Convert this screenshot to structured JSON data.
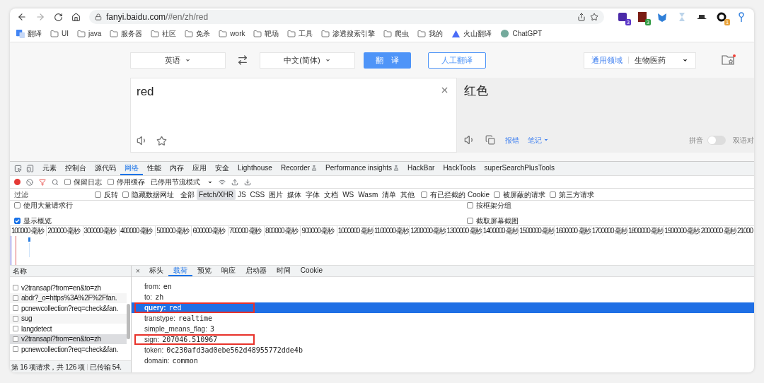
{
  "browser": {
    "host": "fanyi.baidu.com",
    "path": "/#en/zh/red",
    "extensions": [
      {
        "kind": "cube",
        "badge": "3",
        "color": "#5b36c9"
      },
      {
        "kind": "book",
        "badge": "3",
        "color": "#2f9a41"
      },
      {
        "kind": "fox"
      },
      {
        "kind": "hourglass"
      },
      {
        "kind": "hat"
      },
      {
        "kind": "ring",
        "badge": "1",
        "color": "#e8a23a"
      },
      {
        "kind": "pin"
      }
    ],
    "bookmarks": [
      {
        "label": "翻译",
        "kind": "translate"
      },
      {
        "label": "UI",
        "kind": "folder"
      },
      {
        "label": "java",
        "kind": "folder"
      },
      {
        "label": "服务器",
        "kind": "folder"
      },
      {
        "label": "社区",
        "kind": "folder"
      },
      {
        "label": "免杀",
        "kind": "folder"
      },
      {
        "label": "work",
        "kind": "folder"
      },
      {
        "label": "靶场",
        "kind": "folder"
      },
      {
        "label": "工具",
        "kind": "folder"
      },
      {
        "label": "渗透搜索引擎",
        "kind": "folder"
      },
      {
        "label": "爬虫",
        "kind": "folder"
      },
      {
        "label": "我的",
        "kind": "folder"
      },
      {
        "label": "火山翻译",
        "kind": "volcano"
      },
      {
        "label": "ChatGPT",
        "kind": "chatgpt"
      }
    ]
  },
  "translator": {
    "source_lang": "英语",
    "target_lang": "中文(简体)",
    "translate_button": "翻　译",
    "human_button": "人工翻译",
    "domain_label": "通用领域",
    "domain_value": "生物医药",
    "source_text": "red",
    "result_text": "红色",
    "report_link": "报错",
    "notes_link": "笔记",
    "pinyin_label": "拼音",
    "pinyin_on": false,
    "bilingual_label": "双语对"
  },
  "devtools": {
    "tabs": [
      {
        "label": "元素",
        "selected": false,
        "beta": false
      },
      {
        "label": "控制台",
        "selected": false,
        "beta": false
      },
      {
        "label": "源代码",
        "selected": false,
        "beta": false
      },
      {
        "label": "网络",
        "selected": true,
        "beta": false
      },
      {
        "label": "性能",
        "selected": false,
        "beta": false
      },
      {
        "label": "内存",
        "selected": false,
        "beta": false
      },
      {
        "label": "应用",
        "selected": false,
        "beta": false
      },
      {
        "label": "安全",
        "selected": false,
        "beta": false
      },
      {
        "label": "Lighthouse",
        "selected": false,
        "beta": false
      },
      {
        "label": "Recorder",
        "selected": false,
        "beta": true
      },
      {
        "label": "Performance insights",
        "selected": false,
        "beta": true
      },
      {
        "label": "HackBar",
        "selected": false,
        "beta": false
      },
      {
        "label": "HackTools",
        "selected": false,
        "beta": false
      },
      {
        "label": "superSearchPlusTools",
        "selected": false,
        "beta": false
      }
    ],
    "recording": true,
    "toolbar_checks": [
      {
        "label": "保留日志",
        "checked": false
      },
      {
        "label": "停用缓存",
        "checked": false
      }
    ],
    "throttling": "已停用节流模式",
    "filter_placeholder": "过滤",
    "filter_checks": [
      {
        "label": "反转",
        "checked": false
      },
      {
        "label": "隐藏数据网址",
        "checked": false
      }
    ],
    "types": [
      {
        "label": "全部",
        "selected": false
      },
      {
        "label": "Fetch/XHR",
        "selected": true
      },
      {
        "label": "JS",
        "selected": false
      },
      {
        "label": "CSS",
        "selected": false
      },
      {
        "label": "图片",
        "selected": false
      },
      {
        "label": "媒体",
        "selected": false
      },
      {
        "label": "字体",
        "selected": false
      },
      {
        "label": "文档",
        "selected": false
      },
      {
        "label": "WS",
        "selected": false
      },
      {
        "label": "Wasm",
        "selected": false
      },
      {
        "label": "清单",
        "selected": false
      },
      {
        "label": "其他",
        "selected": false
      }
    ],
    "extra_checks": [
      {
        "label": "有已拦截的 Cookie",
        "checked": false
      },
      {
        "label": "被屏蔽的请求",
        "checked": false
      },
      {
        "label": "第三方请求",
        "checked": false
      }
    ],
    "options": [
      {
        "label": "使用大量请求行",
        "checked": false
      },
      {
        "label": "按框架分组",
        "checked": false
      },
      {
        "label": "显示概览",
        "checked": true
      },
      {
        "label": "截取屏幕截图",
        "checked": false
      }
    ],
    "timeline_ticks": [
      "100000 毫秒",
      "200000 毫秒",
      "300000 毫秒",
      "400000 毫秒",
      "500000 毫秒",
      "600000 毫秒",
      "700000 毫秒",
      "800000 毫秒",
      "900000 毫秒",
      "1000000 毫秒",
      "1100000 毫秒",
      "1200000 毫秒",
      "1300000 毫秒",
      "1400000 毫秒",
      "1500000 毫秒",
      "1600000 毫秒",
      "1700000 毫秒",
      "1800000 毫秒",
      "1900000 毫秒",
      "2000000 毫秒",
      "21000"
    ],
    "requests_header": "名称",
    "requests": [
      {
        "name": "v2transapi?from=en&to=zh",
        "selected": false
      },
      {
        "name": "abdr?_o=https%3A%2F%2Ffan.",
        "selected": false
      },
      {
        "name": "pcnewcollection?req=check&fan.",
        "selected": false
      },
      {
        "name": "sug",
        "selected": false
      },
      {
        "name": "langdetect",
        "selected": false
      },
      {
        "name": "v2transapi?from=en&to=zh",
        "selected": true
      },
      {
        "name": "pcnewcollection?req=check&fan.",
        "selected": false
      }
    ],
    "status": "第 16 项请求，共 126 项",
    "transferred": "已传输 54.",
    "close_glyph": "×",
    "detail_tabs": [
      {
        "label": "标头",
        "selected": false
      },
      {
        "label": "载荷",
        "selected": true
      },
      {
        "label": "预览",
        "selected": false
      },
      {
        "label": "响应",
        "selected": false
      },
      {
        "label": "启动器",
        "selected": false
      },
      {
        "label": "时间",
        "selected": false
      },
      {
        "label": "Cookie",
        "selected": false
      }
    ],
    "params": [
      {
        "key": "from:",
        "value": "en",
        "selected": false,
        "outlined": false
      },
      {
        "key": "to:",
        "value": "zh",
        "selected": false,
        "outlined": false
      },
      {
        "key": "query:",
        "value": "red",
        "selected": true,
        "outlined": true
      },
      {
        "key": "transtype:",
        "value": "realtime",
        "selected": false,
        "outlined": false
      },
      {
        "key": "simple_means_flag:",
        "value": "3",
        "selected": false,
        "outlined": false
      },
      {
        "key": "sign:",
        "value": "207046.510967",
        "selected": false,
        "outlined": true
      },
      {
        "key": "token:",
        "value": "0c230afd3ad0ebe562d48955772dde4b",
        "selected": false,
        "outlined": false
      },
      {
        "key": "domain:",
        "value": "common",
        "selected": false,
        "outlined": false
      }
    ]
  }
}
